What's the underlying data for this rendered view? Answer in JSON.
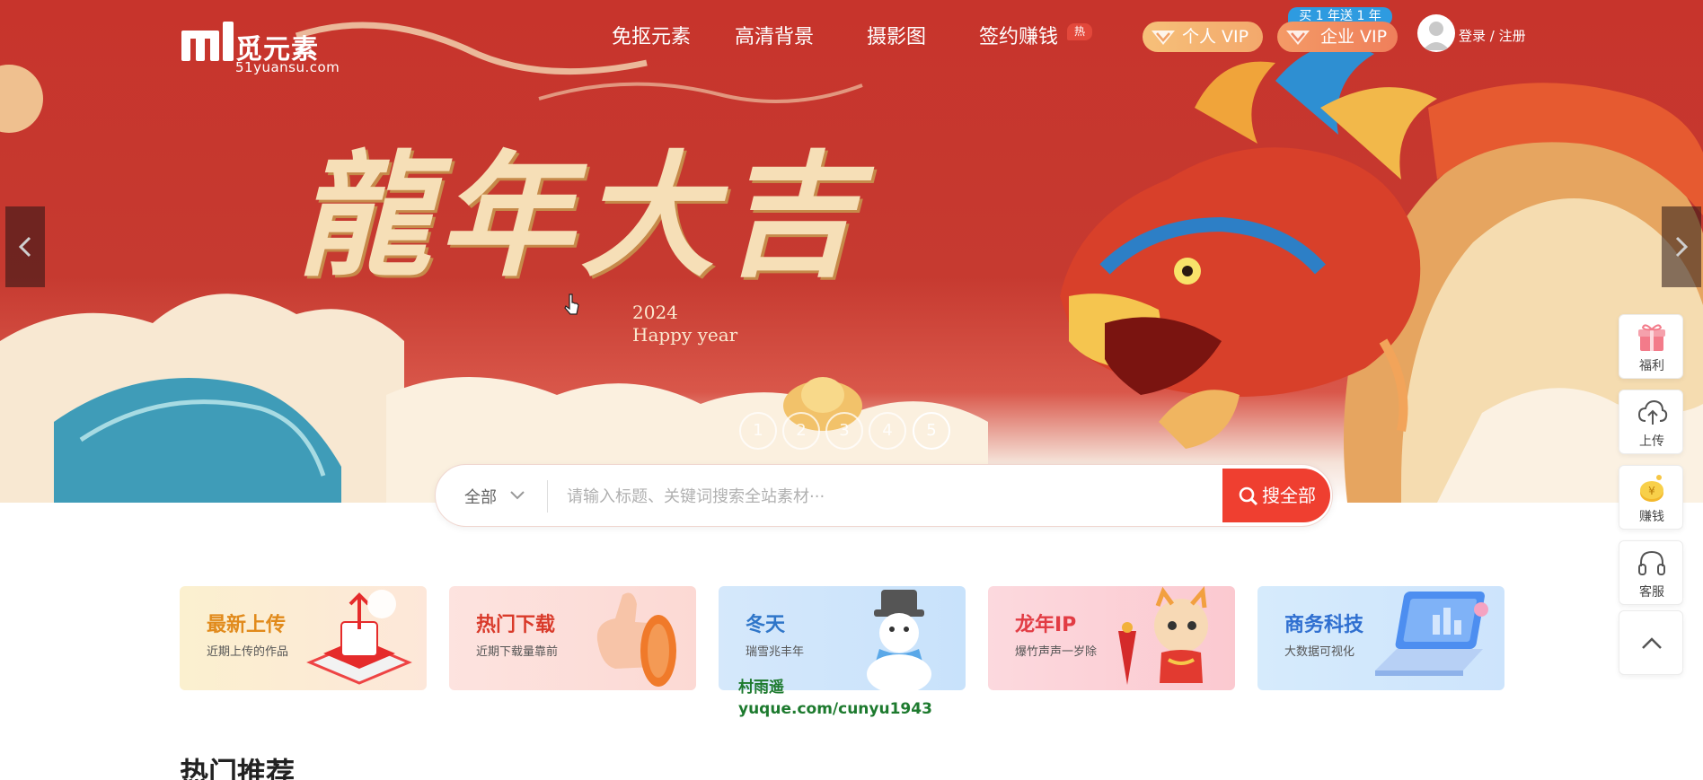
{
  "brand": {
    "logo_cn": "觅元素",
    "logo_en": "51yuansu.com"
  },
  "nav": {
    "items": [
      {
        "label": "免抠元素"
      },
      {
        "label": "高清背景"
      },
      {
        "label": "摄影图"
      },
      {
        "label": "签约赚钱"
      }
    ],
    "hot_badge": "热",
    "vip_personal": "个人 VIP",
    "vip_enterprise": "企业 VIP",
    "promo_badge": "买 1 年送 1 年",
    "login": "登录 / 注册"
  },
  "banner": {
    "headline": "龍年大吉",
    "year": "2024",
    "tagline": "Happy year",
    "dots": [
      "1",
      "2",
      "3",
      "4",
      "5"
    ],
    "active_dot": 5
  },
  "search": {
    "scope": "全部",
    "placeholder": "请输入标题、关键词搜索全站素材···",
    "button": "搜全部"
  },
  "categories": [
    {
      "title": "最新上传",
      "subtitle": "近期上传的作品",
      "title_color": "#e18a1b",
      "bg": "#fbeecb"
    },
    {
      "title": "热门下载",
      "subtitle": "近期下载量靠前",
      "title_color": "#d93a2a",
      "bg": "#fde0dc"
    },
    {
      "title": "冬天",
      "subtitle": "瑞雪兆丰年",
      "title_color": "#2f76c9",
      "bg": "#d6e9fb"
    },
    {
      "title": "龙年IP",
      "subtitle": "爆竹声声一岁除",
      "title_color": "#e23c44",
      "bg": "#fcd9dd"
    },
    {
      "title": "商务科技",
      "subtitle": "大数据可视化",
      "title_color": "#2f6fd0",
      "bg": "#d6ebfc"
    }
  ],
  "watermark": {
    "line1": "村雨遥",
    "line2": "yuque.com/cunyu1943"
  },
  "section_title": "热门推荐",
  "side_toolbar": [
    {
      "label": "福利",
      "icon": "gift-icon"
    },
    {
      "label": "上传",
      "icon": "cloud-upload-icon"
    },
    {
      "label": "赚钱",
      "icon": "coin-icon"
    },
    {
      "label": "客服",
      "icon": "headset-icon"
    },
    {
      "label": "",
      "icon": "back-to-top-icon"
    }
  ]
}
